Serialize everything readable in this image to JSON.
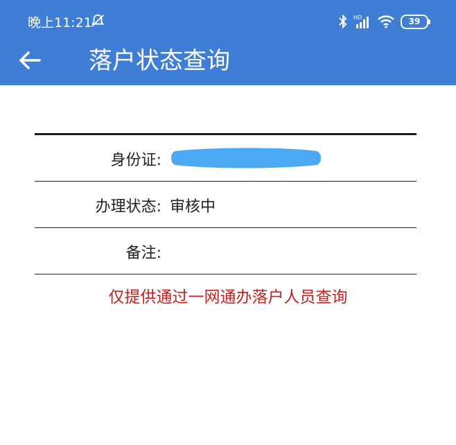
{
  "status_bar": {
    "time": "晚上11:21",
    "battery": "39",
    "icons": [
      "do-not-disturb-icon",
      "bluetooth-icon",
      "hd-signal-icon",
      "wifi-icon",
      "battery-icon"
    ]
  },
  "header": {
    "title": "落户状态查询",
    "back_icon": "arrow-left-icon",
    "color": "#3f7ed6"
  },
  "records": [
    {
      "label": "身份证:",
      "value": ""
    },
    {
      "label": "办理状态:",
      "value": "审核中"
    },
    {
      "label": "备注:",
      "value": ""
    }
  ],
  "notice": {
    "text": "仅提供通过一网通办落户人员查询",
    "color": "#c42221"
  }
}
